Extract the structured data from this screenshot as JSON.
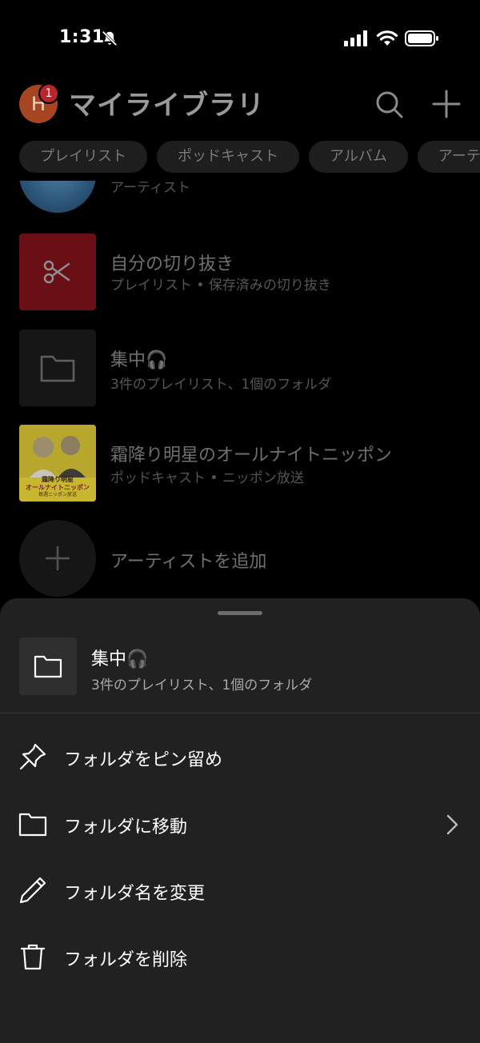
{
  "status_bar": {
    "time": "1:31"
  },
  "header": {
    "avatar_letter": "H",
    "badge_count": "1",
    "title": "マイライブラリ"
  },
  "chips": [
    "プレイリスト",
    "ポッドキャスト",
    "アルバム",
    "アーテ"
  ],
  "list": {
    "partial_item_sub": "アーティスト",
    "items": [
      {
        "title": "自分の切り抜き",
        "subtitle": "プレイリスト • 保存済みの切り抜き"
      },
      {
        "title": "集中🎧",
        "subtitle": "3件のプレイリスト、1個のフォルダ"
      },
      {
        "title": "霜降り明星のオールナイトニッポン",
        "subtitle": "ポッドキャスト • ニッポン放送"
      },
      {
        "title": "アーティストを追加"
      }
    ],
    "podcast_art_text": [
      "霜降り明星",
      "オールナイトニッポン",
      "毎週ニッポン放送"
    ]
  },
  "sheet": {
    "title": "集中🎧",
    "subtitle": "3件のプレイリスト、1個のフォルダ",
    "menu": [
      {
        "label": "フォルダをピン留め",
        "icon": "pin-icon"
      },
      {
        "label": "フォルダに移動",
        "icon": "folder-icon"
      },
      {
        "label": "フォルダ名を変更",
        "icon": "pencil-icon"
      },
      {
        "label": "フォルダを削除",
        "icon": "trash-icon"
      }
    ]
  },
  "colors": {
    "background": "#000000",
    "sheet": "#212121",
    "clip_thumb": "#6a0f15",
    "avatar": "#a64522",
    "badge": "#b7262c"
  }
}
